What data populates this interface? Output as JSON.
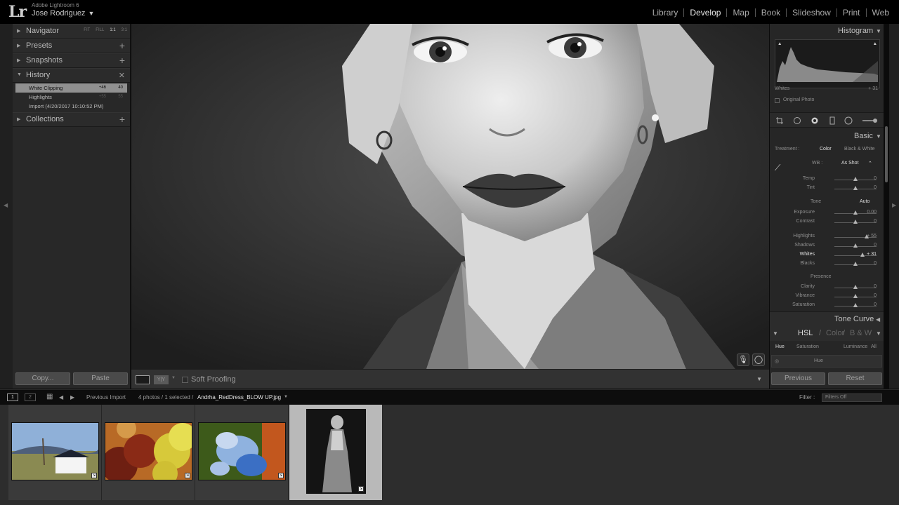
{
  "app": {
    "name": "Adobe Lightroom 6",
    "user": "Jose Rodriguez"
  },
  "modules": [
    "Library",
    "Develop",
    "Map",
    "Book",
    "Slideshow",
    "Print",
    "Web"
  ],
  "active_module": "Develop",
  "left_panel": {
    "navigator": {
      "label": "Navigator",
      "zooms": [
        "FIT",
        "FILL",
        "1:1",
        "3:1"
      ]
    },
    "presets": "Presets",
    "snapshots": "Snapshots",
    "history": {
      "label": "History",
      "items": [
        {
          "label": "White Clipping",
          "a": "+46",
          "b": "40"
        },
        {
          "label": "Highlights",
          "a": "+55",
          "b": "55"
        },
        {
          "label": "Import (4/20/2017 10:10:52 PM)",
          "a": "",
          "b": ""
        }
      ]
    },
    "collections": "Collections",
    "copy_label": "Copy...",
    "paste_label": "Paste"
  },
  "toolbar": {
    "soft_proofing": "Soft Proofing"
  },
  "right_panel": {
    "histogram": {
      "title": "Histogram",
      "readout_label": "Whites",
      "readout_value": "+ 31",
      "original_photo": "Original Photo"
    },
    "basic": {
      "title": "Basic",
      "treatment_label": "Treatment :",
      "treatment_color": "Color",
      "treatment_bw": "Black & White",
      "wb_label": "WB :",
      "wb_value": "As Shot",
      "tone_label": "Tone",
      "auto_label": "Auto",
      "presence_label": "Presence",
      "sliders": [
        {
          "label": "Temp",
          "value": "0",
          "pos": 0.5
        },
        {
          "label": "Tint",
          "value": "0",
          "pos": 0.5
        },
        {
          "label": "Exposure",
          "value": "0.00",
          "pos": 0.5
        },
        {
          "label": "Contrast",
          "value": "0",
          "pos": 0.5
        },
        {
          "label": "Highlights",
          "value": "+ 55",
          "pos": 0.77
        },
        {
          "label": "Shadows",
          "value": "0",
          "pos": 0.5
        },
        {
          "label": "Whites",
          "value": "+ 31",
          "pos": 0.66
        },
        {
          "label": "Blacks",
          "value": "0",
          "pos": 0.5
        },
        {
          "label": "Clarity",
          "value": "0",
          "pos": 0.5
        },
        {
          "label": "Vibrance",
          "value": "0",
          "pos": 0.5
        },
        {
          "label": "Saturation",
          "value": "0",
          "pos": 0.5
        }
      ]
    },
    "tone_curve": "Tone Curve",
    "hsl": {
      "hsl": "HSL",
      "color": "Color",
      "bw": "B & W",
      "tabs": [
        "Hue",
        "Saturation",
        "Luminance",
        "All"
      ],
      "hue_label": "Hue"
    },
    "previous_label": "Previous",
    "reset_label": "Reset"
  },
  "filmstrip": {
    "page1": "1",
    "page2": "2",
    "source": "Previous Import",
    "count": "4 photos / 1 selected /",
    "filename": "Andrha_RedDress_BLOW UP.jpg",
    "filter_label": "Filter :",
    "filter_value": "Filters Off"
  }
}
